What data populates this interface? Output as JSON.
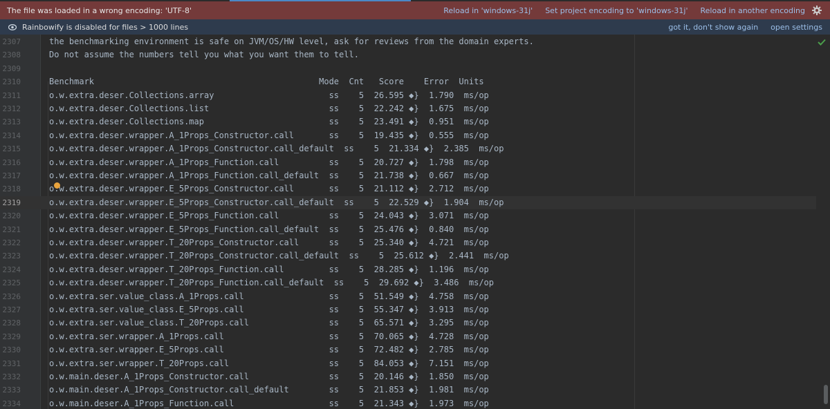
{
  "encoding_banner": {
    "message": "The file was loaded in a wrong encoding: 'UTF-8'",
    "reload_windows_label": "Reload in 'windows-31j'",
    "set_project_encoding_label": "Set project encoding to 'windows-31j'",
    "reload_another_label": "Reload in another encoding"
  },
  "rainbow_banner": {
    "message": "Rainbowify is disabled for files > 1000 lines",
    "got_it_label": "got it, don't show again",
    "open_settings_label": "open settings"
  },
  "editor": {
    "current_line": "2319",
    "lines": [
      {
        "n": "2307",
        "t": "the benchmarking environment is safe on JVM/OS/HW level, ask for reviews from the domain experts."
      },
      {
        "n": "2308",
        "t": "Do not assume the numbers tell you what you want them to tell."
      },
      {
        "n": "2309",
        "t": ""
      },
      {
        "n": "2310",
        "t": "Benchmark                                             Mode  Cnt   Score    Error  Units"
      },
      {
        "n": "2311",
        "t": "o.w.extra.deser.Collections.array                       ss    5  26.595 ◆}  1.790  ms/op"
      },
      {
        "n": "2312",
        "t": "o.w.extra.deser.Collections.list                        ss    5  22.242 ◆}  1.675  ms/op"
      },
      {
        "n": "2313",
        "t": "o.w.extra.deser.Collections.map                         ss    5  23.491 ◆}  0.951  ms/op"
      },
      {
        "n": "2314",
        "t": "o.w.extra.deser.wrapper.A_1Props_Constructor.call       ss    5  19.435 ◆}  0.555  ms/op"
      },
      {
        "n": "2315",
        "t": "o.w.extra.deser.wrapper.A_1Props_Constructor.call_default  ss    5  21.334 ◆}  2.385  ms/op"
      },
      {
        "n": "2316",
        "t": "o.w.extra.deser.wrapper.A_1Props_Function.call          ss    5  20.727 ◆}  1.798  ms/op"
      },
      {
        "n": "2317",
        "t": "o.w.extra.deser.wrapper.A_1Props_Function.call_default  ss    5  21.738 ◆}  0.667  ms/op"
      },
      {
        "n": "2318",
        "t": "o.w.extra.deser.wrapper.E_5Props_Constructor.call       ss    5  21.112 ◆}  2.712  ms/op"
      },
      {
        "n": "2319",
        "t": "o.w.extra.deser.wrapper.E_5Props_Constructor.call_default  ss    5  22.529 ◆}  1.904  ms/op"
      },
      {
        "n": "2320",
        "t": "o.w.extra.deser.wrapper.E_5Props_Function.call          ss    5  24.043 ◆}  3.071  ms/op"
      },
      {
        "n": "2321",
        "t": "o.w.extra.deser.wrapper.E_5Props_Function.call_default  ss    5  25.476 ◆}  0.840  ms/op"
      },
      {
        "n": "2322",
        "t": "o.w.extra.deser.wrapper.T_20Props_Constructor.call      ss    5  25.340 ◆}  4.721  ms/op"
      },
      {
        "n": "2323",
        "t": "o.w.extra.deser.wrapper.T_20Props_Constructor.call_default  ss    5  25.612 ◆}  2.441  ms/op"
      },
      {
        "n": "2324",
        "t": "o.w.extra.deser.wrapper.T_20Props_Function.call         ss    5  28.285 ◆}  1.196  ms/op"
      },
      {
        "n": "2325",
        "t": "o.w.extra.deser.wrapper.T_20Props_Function.call_default  ss    5  29.692 ◆}  3.486  ms/op"
      },
      {
        "n": "2326",
        "t": "o.w.extra.ser.value_class.A_1Props.call                 ss    5  51.549 ◆}  4.758  ms/op"
      },
      {
        "n": "2327",
        "t": "o.w.extra.ser.value_class.E_5Props.call                 ss    5  55.347 ◆}  3.913  ms/op"
      },
      {
        "n": "2328",
        "t": "o.w.extra.ser.value_class.T_20Props.call                ss    5  65.571 ◆}  3.295  ms/op"
      },
      {
        "n": "2329",
        "t": "o.w.extra.ser.wrapper.A_1Props.call                     ss    5  70.065 ◆}  4.728  ms/op"
      },
      {
        "n": "2330",
        "t": "o.w.extra.ser.wrapper.E_5Props.call                     ss    5  72.482 ◆}  2.785  ms/op"
      },
      {
        "n": "2331",
        "t": "o.w.extra.ser.wrapper.T_20Props.call                    ss    5  84.053 ◆}  7.151  ms/op"
      },
      {
        "n": "2332",
        "t": "o.w.main.deser.A_1Props_Constructor.call                ss    5  20.146 ◆}  1.850  ms/op"
      },
      {
        "n": "2333",
        "t": "o.w.main.deser.A_1Props_Constructor.call_default        ss    5  21.853 ◆}  1.981  ms/op"
      },
      {
        "n": "2334",
        "t": "o.w.main.deser.A_1Props_Function.call                   ss    5  21.343 ◆}  1.973  ms/op"
      }
    ]
  },
  "icons": {
    "settings": "gear-icon",
    "rainbow": "eye-icon",
    "inspection": "checkmark-icon",
    "gutter_marker": "breakpoint-dot-icon"
  },
  "colors": {
    "error_banner": "#743a3a",
    "info_banner": "#2e3b4d",
    "link": "#9cbfe8",
    "editor_bg": "#2b2b2b",
    "gutter_bg": "#313335",
    "code_text": "#a9b7c6",
    "breakpoint": "#e8a33d",
    "check": "#4b9e4b"
  }
}
